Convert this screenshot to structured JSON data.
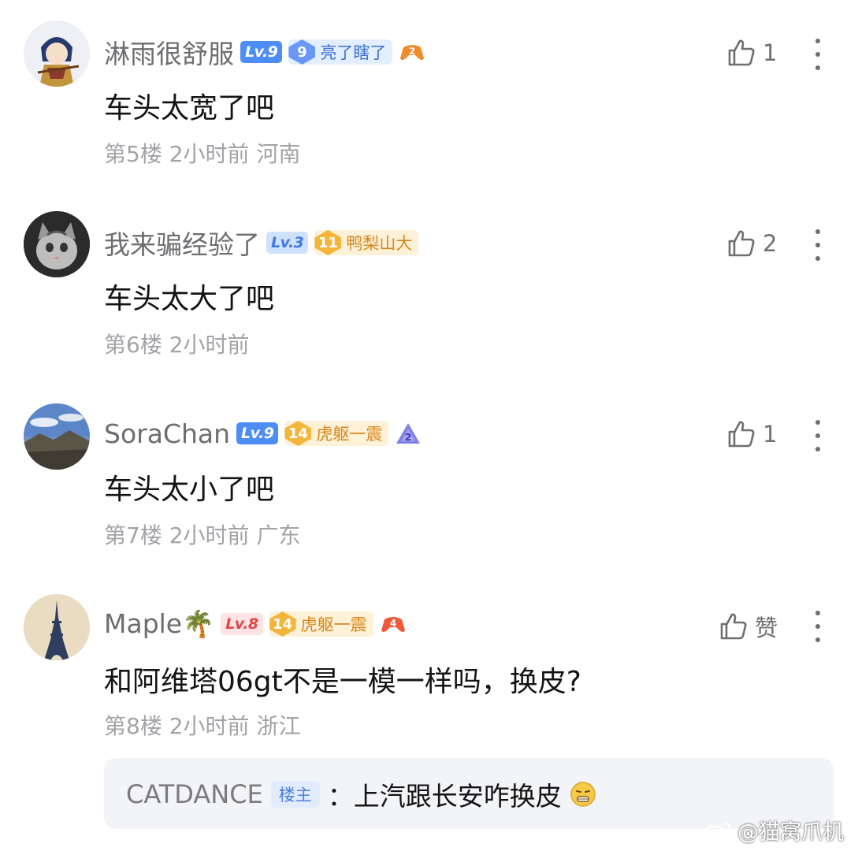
{
  "comments": [
    {
      "username": "淋雨很舒服",
      "level": "Lv.9",
      "fan_level": "9",
      "fan_name": "亮了瞎了",
      "game_badge": "2",
      "content": "车头太宽了吧",
      "floor": "第5楼",
      "time": "2小时前",
      "location": "河南",
      "likes": "1"
    },
    {
      "username": "我来骗经验了",
      "level": "Lv.3",
      "fan_level": "11",
      "fan_name": "鸭梨山大",
      "content": "车头太大了吧",
      "floor": "第6楼",
      "time": "2小时前",
      "location": "",
      "likes": "2"
    },
    {
      "username": "SoraChan",
      "level": "Lv.9",
      "fan_level": "14",
      "fan_name": "虎躯一震",
      "game_badge": "2",
      "content": "车头太小了吧",
      "floor": "第7楼",
      "time": "2小时前",
      "location": "广东",
      "likes": "1"
    },
    {
      "username": "Maple🌴",
      "level": "Lv.8",
      "fan_level": "14",
      "fan_name": "虎躯一震",
      "game_badge": "4",
      "content": "和阿维塔06gt不是一模一样吗，换皮?",
      "floor": "第8楼",
      "time": "2小时前",
      "location": "浙江",
      "likes": "赞"
    }
  ],
  "reply": {
    "username": "CATDANCE",
    "op_tag": "楼主",
    "text": "：上汽跟长安咋换皮",
    "emoji": "grimace-emoji"
  },
  "watermark": {
    "text": "@猫窝爪机",
    "icon": "weibo-icon"
  },
  "icons": {
    "like": "thumbs-up-icon",
    "more": "more-vertical-icon"
  },
  "colors": {
    "level_blue": "#4e8df5",
    "level_pink": "#e04848",
    "fan_blue": "#3a6fd6",
    "fan_gold": "#d8871a",
    "meta_gray": "#a3a3a8"
  }
}
